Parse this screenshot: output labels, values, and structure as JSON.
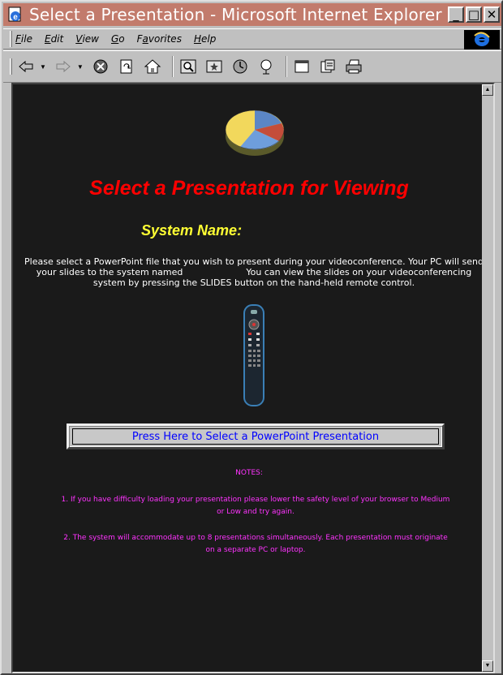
{
  "window": {
    "title": "Select a Presentation - Microsoft Internet Explorer",
    "minimize": "_",
    "maximize": "□",
    "close": "✕"
  },
  "menubar": {
    "items": [
      {
        "label": "File",
        "key": "F"
      },
      {
        "label": "Edit",
        "key": "E"
      },
      {
        "label": "View",
        "key": "V"
      },
      {
        "label": "Go",
        "key": "G"
      },
      {
        "label": "Favorites",
        "key": "a"
      },
      {
        "label": "Help",
        "key": "H"
      }
    ]
  },
  "toolbar": {
    "buttons": [
      "back-icon",
      "forward-icon",
      "stop-icon",
      "refresh-icon",
      "home-icon",
      "search-icon",
      "favorites-icon",
      "history-icon",
      "channels-icon",
      "fullscreen-icon",
      "mail-icon",
      "print-icon"
    ]
  },
  "page": {
    "heading": "Select a Presentation for Viewing",
    "system_name_label": "System Name:",
    "instructions_line1": "Please select a PowerPoint file that you wish to present during your videoconference. Your PC will send",
    "instructions_line2a": "your slides to the system named",
    "instructions_line2b": "You can view the slides on your videoconferencing",
    "instructions_line3": "system by pressing the SLIDES button on the hand-held remote control.",
    "select_button": "Press Here to Select a PowerPoint Presentation",
    "notes_title": "NOTES:",
    "note1_line1": "1.  If you have difficulty loading your presentation please lower the safety level of your browser to Medium",
    "note1_line2": "or Low and try again.",
    "note2_line1": "2.  The system will accommodate up to 8 presentations simultaneously.  Each presentation must originate",
    "note2_line2": "on a separate PC or laptop."
  },
  "colors": {
    "titlebar": "#c27b6c",
    "background": "#1a1a1a",
    "heading": "#ff0000",
    "system_name": "#ffff33",
    "notes": "#ff33ff",
    "button_text": "#0000ff"
  }
}
